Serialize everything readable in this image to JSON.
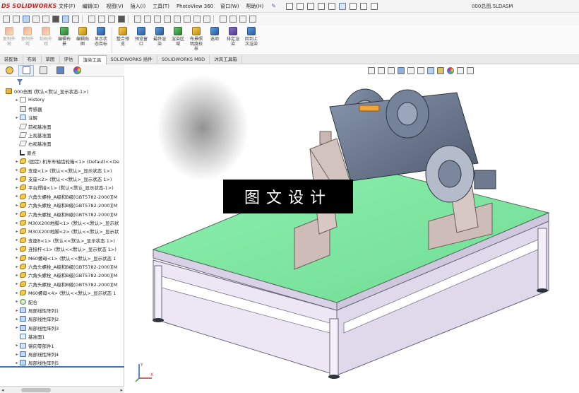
{
  "app": {
    "logo_prefix": "DS",
    "logo_text": "SOLIDWORKS",
    "document_title": "000总图.SLDASM",
    "colors": {
      "brand": "#d02020",
      "accent": "#3a73c4",
      "tabletop": "#7fe6a1",
      "frame": "#ece6f5",
      "column": "#d5c3c0",
      "machine": "#6f7f96"
    }
  },
  "menu": {
    "items": [
      "文件(F)",
      "编辑(E)",
      "视图(V)",
      "插入(I)",
      "工具(T)",
      "PhotoView 360",
      "窗口(W)",
      "帮助(H)"
    ],
    "pin_icon": "pin-icon"
  },
  "ribbon": {
    "buttons": [
      {
        "label": "复制外\n观",
        "disabled": true
      },
      {
        "label": "复制外\n观",
        "disabled": true
      },
      {
        "label": "粘贴外\n观",
        "disabled": true
      },
      {
        "label": "编辑布\n景",
        "disabled": false
      },
      {
        "label": "编辑贴\n图",
        "disabled": false
      },
      {
        "label": "显示状\n态目标",
        "disabled": false
      },
      {
        "label": "整合预\n览",
        "disabled": false
      },
      {
        "label": "预览窗\n口",
        "disabled": false
      },
      {
        "label": "最终渲\n染",
        "disabled": false
      },
      {
        "label": "渲染区\n域",
        "disabled": false
      },
      {
        "label": "布景照\n明度校\n样",
        "disabled": false
      },
      {
        "label": "选项",
        "disabled": false
      },
      {
        "label": "排定渲\n染",
        "disabled": false
      },
      {
        "label": "回到上\n次渲染",
        "disabled": false
      }
    ]
  },
  "cm_tabs": [
    "装配体",
    "布局",
    "草图",
    "评估",
    "渲染工具",
    "SOLIDWORKS 插件",
    "SOLIDWORKS MBD",
    "沐风工具箱"
  ],
  "cm_active_tab": "渲染工具",
  "tree": {
    "root": "000总图 (默认<默认_显示状态-1>)",
    "items": [
      {
        "icon": "history",
        "expand": "▸",
        "text": "History"
      },
      {
        "icon": "sensor",
        "expand": " ",
        "text": "传感器"
      },
      {
        "icon": "note",
        "expand": "▸",
        "text": "注解"
      },
      {
        "icon": "plane",
        "expand": " ",
        "text": "前视基准面"
      },
      {
        "icon": "plane",
        "expand": " ",
        "text": "上视基准面"
      },
      {
        "icon": "plane",
        "expand": " ",
        "text": "右视基准面"
      },
      {
        "icon": "origin",
        "expand": " ",
        "text": "原点"
      },
      {
        "icon": "part",
        "expand": "▸",
        "text": "(固定) 机车车轴齿轮箱<1> (Default<<De"
      },
      {
        "icon": "part",
        "expand": "▸",
        "text": "支座<1> (默认<<默认>_显示状态 1>)"
      },
      {
        "icon": "part",
        "expand": "▸",
        "text": "支座<2> (默认<<默认>_显示状态 1>)"
      },
      {
        "icon": "part",
        "expand": "▸",
        "text": "平台焊接<1> (默认<默认_显示状态-1>)"
      },
      {
        "icon": "part",
        "expand": "▸",
        "text": "六角头螺栓_A级和B级[GBT5782-2000][M"
      },
      {
        "icon": "part",
        "expand": "▸",
        "text": "六角头螺栓_A级和B级[GBT5782-2000][M"
      },
      {
        "icon": "part",
        "expand": "▸",
        "text": "六角头螺栓_A级和B级[GBT5782-2000][M"
      },
      {
        "icon": "part",
        "expand": "▸",
        "text": "M30X200地脚<1> (默认<<默认>_显示状"
      },
      {
        "icon": "part",
        "expand": "▸",
        "text": "M30X200地脚<2> (默认<<默认>_显示状"
      },
      {
        "icon": "part",
        "expand": "▸",
        "text": "支座B<1> (默认<<默认>_显示状态 1>)"
      },
      {
        "icon": "part",
        "expand": "▸",
        "text": "连接杆<1> (默认<<默认>_显示状态 1>)"
      },
      {
        "icon": "part",
        "expand": "▸",
        "text": "M60螺母<1> (默认<<默认>_显示状态 1"
      },
      {
        "icon": "part",
        "expand": "▸",
        "text": "六角头螺栓_A级和B级[GBT5782-2000][M"
      },
      {
        "icon": "part",
        "expand": "▸",
        "text": "六角头螺栓_A级和B级[GBT5782-2000][M"
      },
      {
        "icon": "part",
        "expand": "▸",
        "text": "六角头螺栓_A级和B级[GBT5782-2000][M"
      },
      {
        "icon": "part",
        "expand": "▸",
        "text": "M60螺母<4> (默认<<默认>_显示状态 1"
      },
      {
        "icon": "mate",
        "expand": "▸",
        "text": "配合"
      },
      {
        "icon": "pattern",
        "expand": "▸",
        "text": "局部线性阵列1"
      },
      {
        "icon": "pattern",
        "expand": "▸",
        "text": "局部线性阵列2"
      },
      {
        "icon": "pattern",
        "expand": "▸",
        "text": "局部线性阵列3"
      },
      {
        "icon": "sketch",
        "expand": " ",
        "text": "基准面1"
      },
      {
        "icon": "mirror",
        "expand": "▸",
        "text": "镜向零部件1"
      },
      {
        "icon": "pattern",
        "expand": "▸",
        "text": "局部线性阵列4"
      },
      {
        "icon": "pattern",
        "expand": "▸",
        "text": "局部线性阵列5"
      }
    ]
  },
  "viewport": {
    "watermark": "图文设计",
    "triad_labels": {
      "x": "X",
      "y": "Y",
      "z": "Z"
    }
  }
}
